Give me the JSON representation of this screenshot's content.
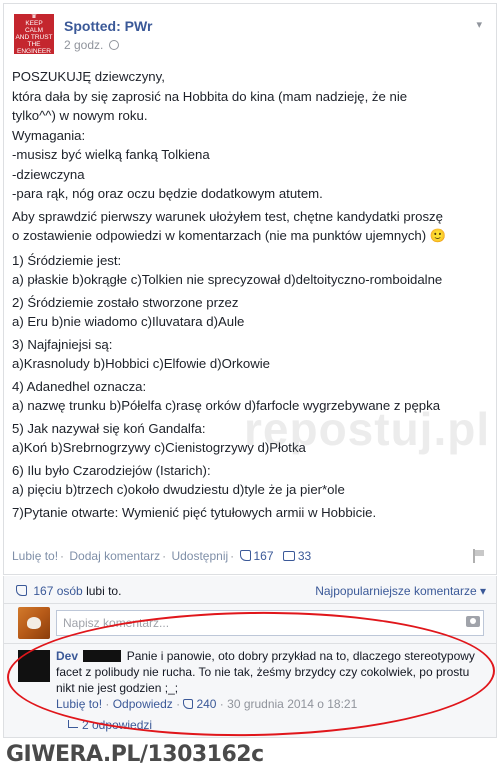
{
  "post": {
    "avatar_text": [
      "KEEP",
      "CALM",
      "AND TRUST",
      "THE",
      "ENGINEER"
    ],
    "page_name": "Spotted: PWr",
    "time": "2 godz.",
    "lines": [
      "POSZUKUJĘ dziewczyny,",
      "która dała by się zaprosić na Hobbita do kina (mam nadzieję, że nie",
      "tylko^^) w nowym roku.",
      "Wymagania:",
      "-musisz być wielką fanką Tolkiena",
      "-dziewczyna",
      "-para rąk, nóg oraz oczu będzie dodatkowym atutem."
    ],
    "intro_lines": [
      "Aby sprawdzić pierwszy warunek ułożyłem test, chętne kandydatki proszę",
      "o zostawienie odpowiedzi w komentarzach (nie ma punktów ujemnych) 🙂"
    ],
    "questions": [
      {
        "q": "1) Śródziemie jest:",
        "a": "a) płaskie b)okrągłe c)Tolkien nie sprecyzował d)deltoityczno-romboidalne"
      },
      {
        "q": "2) Śródziemie zostało stworzone przez",
        "a": "a) Eru b)nie wiadomo c)Iluvatara d)Aule"
      },
      {
        "q": "3) Najfajniejsi są:",
        "a": "a)Krasnoludy b)Hobbici c)Elfowie d)Orkowie"
      },
      {
        "q": "4) Adanedhel oznacza:",
        "a": "a) nazwę trunku b)Półelfa c)rasę orków d)farfocle wygrzebywane z pępka"
      },
      {
        "q": "5) Jak nazywał się koń Gandalfa:",
        "a": "a)Koń b)Srebrnogrzywy c)Cienistogrzywy d)Płotka"
      },
      {
        "q": "6) Ilu było Czarodziejów (Istarich):",
        "a": "a) pięciu b)trzech c)około dwudziestu d)tyle że ja pier*ole"
      }
    ],
    "final_question": "7)Pytanie otwarte: Wymienić pięć tytułowych armii w Hobbicie.",
    "watermark": "repostuj.pl"
  },
  "actions": {
    "like": "Lubię to!",
    "comment": "Dodaj komentarz",
    "share": "Udostępnij",
    "likes_count": "167",
    "comments_count": "33"
  },
  "likes_bar": {
    "count": "167 osób",
    "suffix": "lubi to.",
    "sort": "Najpopularniejsze komentarze ▾"
  },
  "comment_input": {
    "placeholder": "Napisz komentarz..."
  },
  "comment": {
    "author": "Dev",
    "text": "Panie i panowie, oto dobry przykład na to, dlaczego stereotypowy facet z polibudy nie rucha. To nie tak, żeśmy brzydcy czy cokolwiek, po prostu nikt nie jest godzien ;_;",
    "like": "Lubię to!",
    "reply": "Odpowiedz",
    "likes": "240",
    "date": "30 grudnia 2014 o 18:21",
    "replies": "2 odpowiedzi"
  },
  "footer": "GIWERA.PL/1303162c",
  "colors": {
    "fb_blue": "#3b5998",
    "annotation_red": "#e0161b",
    "avatar_red": "#c4262e"
  }
}
